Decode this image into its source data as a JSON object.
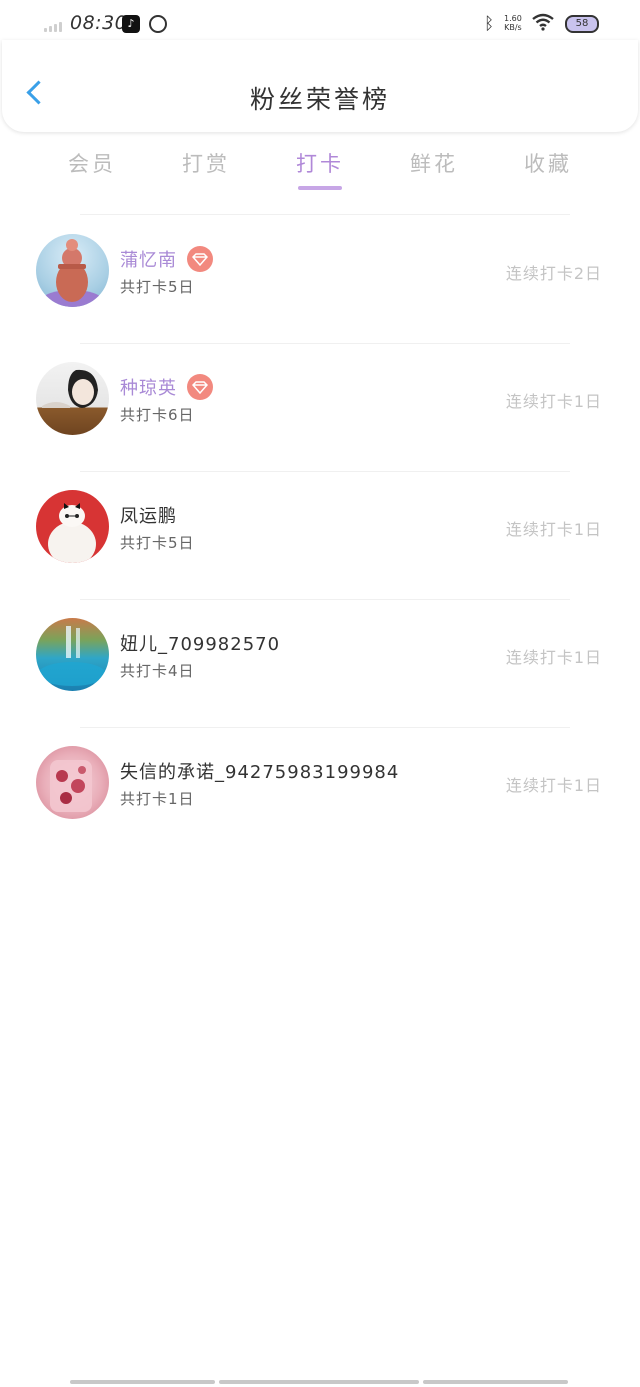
{
  "status": {
    "time": "08:30",
    "net_speed_value": "1.60",
    "net_speed_unit": "KB/s",
    "battery": "58"
  },
  "header": {
    "title": "粉丝荣誉榜"
  },
  "tabs": [
    {
      "label": "会员"
    },
    {
      "label": "打赏"
    },
    {
      "label": "打卡"
    },
    {
      "label": "鲜花"
    },
    {
      "label": "收藏"
    }
  ],
  "active_tab": "打卡",
  "colors": {
    "accent": "#b088d8",
    "back": "#3aa0e8",
    "badge": "#f2897f"
  },
  "fans": [
    {
      "name": "蒲忆南",
      "vip": true,
      "total": "共打卡5日",
      "streak": "连续打卡2日"
    },
    {
      "name": "种琼英",
      "vip": true,
      "total": "共打卡6日",
      "streak": "连续打卡1日"
    },
    {
      "name": "凤运鹏",
      "vip": false,
      "total": "共打卡5日",
      "streak": "连续打卡1日"
    },
    {
      "name": "妞儿_709982570",
      "vip": false,
      "total": "共打卡4日",
      "streak": "连续打卡1日"
    },
    {
      "name": "失信的承诺_94275983199984",
      "vip": false,
      "total": "共打卡1日",
      "streak": "连续打卡1日"
    }
  ]
}
